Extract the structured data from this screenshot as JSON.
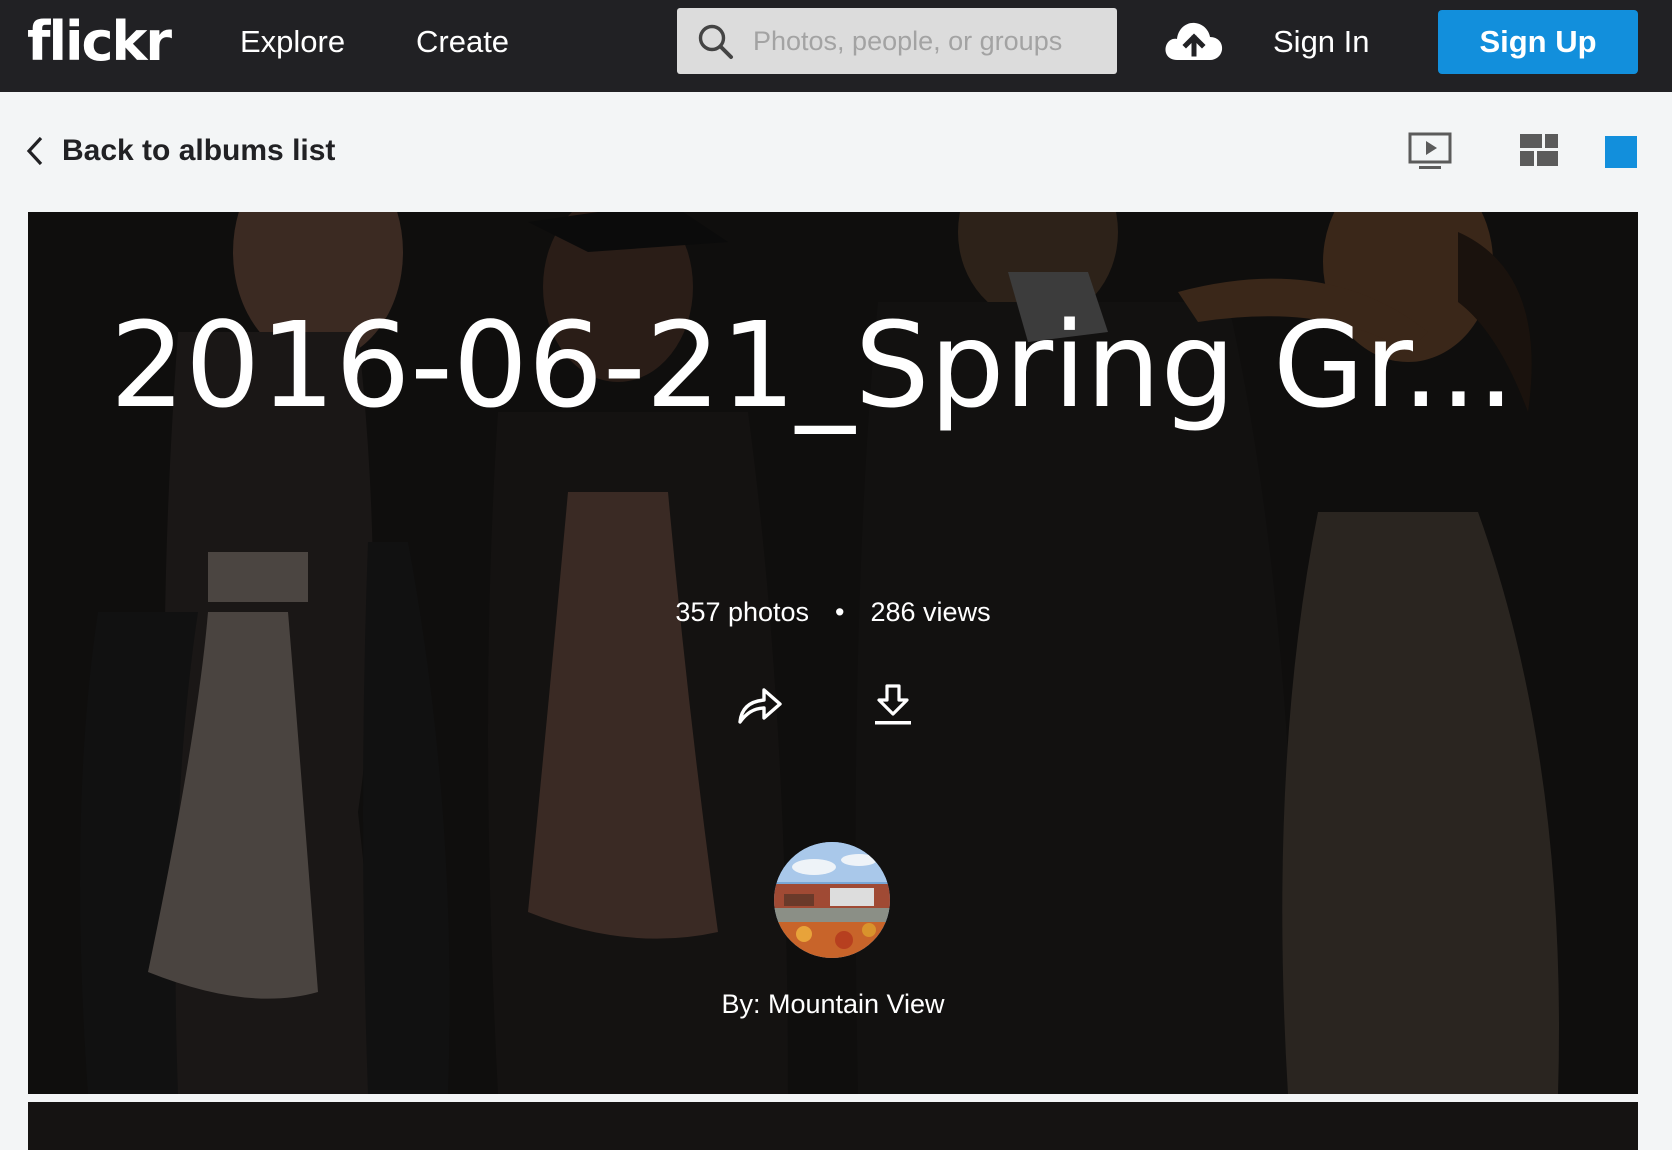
{
  "topbar": {
    "logo": "flickr",
    "nav": {
      "explore": "Explore",
      "create": "Create"
    },
    "search": {
      "placeholder": "Photos, people, or groups",
      "icon": "search-icon"
    },
    "upload_icon": "cloud-upload-icon",
    "sign_in": "Sign In",
    "sign_up": "Sign Up",
    "colors": {
      "bar": "#212124",
      "accent": "#128fdc"
    }
  },
  "subheader": {
    "back_label": "Back to albums list",
    "views": [
      "slideshow-icon",
      "grid-view-icon",
      "single-view-icon"
    ]
  },
  "album": {
    "title": "2016-06-21_Spring Gr...",
    "photos": "357 photos",
    "separator": "•",
    "views": "286 views",
    "actions": [
      "share-icon",
      "download-icon"
    ],
    "owner": "By: Mountain View"
  }
}
